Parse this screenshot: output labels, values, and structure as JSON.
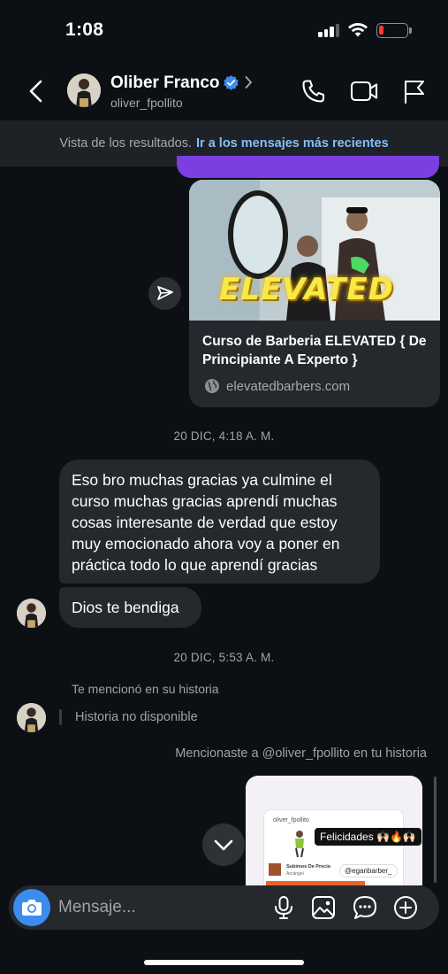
{
  "status_bar": {
    "time": "1:08"
  },
  "header": {
    "name": "Oliber Franco",
    "username": "oliver_fpollito",
    "icons": [
      "back-icon",
      "verified-badge-icon",
      "chevron-right-icon",
      "phone-icon",
      "video-camera-icon",
      "flag-icon"
    ]
  },
  "results_banner": {
    "text": "Vista de los resultados.",
    "link": "Ir a los mensajes más recientes"
  },
  "link_card": {
    "thumbnail_text": "ELEVATED",
    "title": "Curso de Barberia ELEVATED { De Principiante A Experto }",
    "domain": "elevatedbarbers.com"
  },
  "messages": {
    "timestamp_1": "20 DIC, 4:18 A. M.",
    "incoming_1": "Eso bro muchas gracias ya culmine el curso muchas gracias aprendí muchas cosas interesante de verdad que estoy muy emocionado ahora voy a poner en práctica todo lo que aprendí gracias",
    "incoming_2": "Dios te bendiga",
    "timestamp_2": "20 DIC, 5:53 A. M.",
    "mention_in": "Te mencionó en su historia",
    "story_unavailable": "Historia no disponible",
    "mention_out": "Mencionaste a @oliver_fpollito en tu historia"
  },
  "story_preview": {
    "username": "oliver_fpollito",
    "sticker": "Felicidades 🙌🏻🔥🙌🏻",
    "post_title": "Subimos De Precio",
    "post_sub": "Arcángel",
    "tag": "@eganbarber_"
  },
  "composer": {
    "placeholder": "Mensaje...",
    "icons": [
      "camera-icon",
      "microphone-icon",
      "gallery-icon",
      "sticker-icon",
      "plus-icon"
    ]
  },
  "colors": {
    "background": "#0c0f14",
    "bubble": "#25282d",
    "accent_blue": "#3c8cf0",
    "link_blue": "#85bff9",
    "purple": "#7b3ee0"
  }
}
